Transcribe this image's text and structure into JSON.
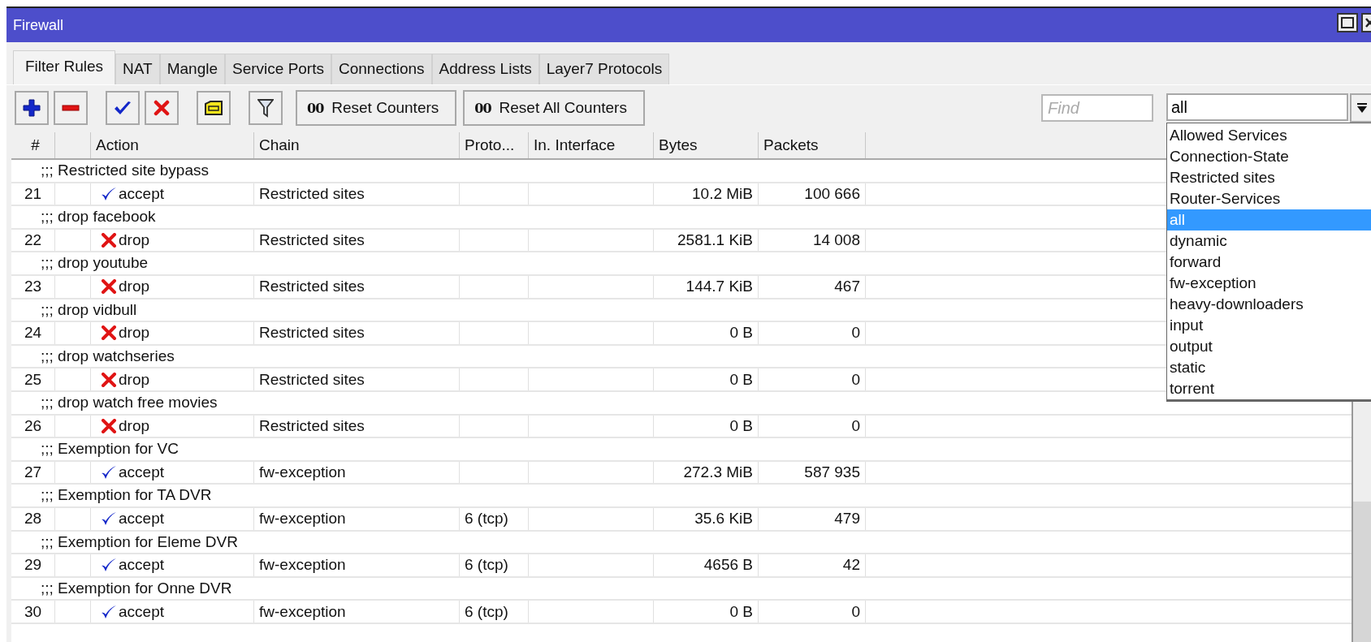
{
  "window": {
    "title": "Firewall"
  },
  "tabs": [
    {
      "label": "Filter Rules",
      "selected": true
    },
    {
      "label": "NAT",
      "selected": false
    },
    {
      "label": "Mangle",
      "selected": false
    },
    {
      "label": "Service Ports",
      "selected": false
    },
    {
      "label": "Connections",
      "selected": false
    },
    {
      "label": "Address Lists",
      "selected": false
    },
    {
      "label": "Layer7 Protocols",
      "selected": false
    }
  ],
  "toolbar": {
    "icon_buttons": [
      {
        "kind": "add"
      },
      {
        "kind": "remove"
      },
      {
        "kind": "enable"
      },
      {
        "kind": "disable"
      },
      {
        "kind": "comment"
      },
      {
        "kind": "filter"
      }
    ],
    "text_buttons": [
      {
        "glyph": "00",
        "label": "Reset Counters"
      },
      {
        "glyph": "00",
        "label": "Reset All Counters"
      }
    ],
    "find": {
      "placeholder": "Find"
    },
    "chain_filter": {
      "value": "all",
      "options": [
        {
          "label": "Allowed Services",
          "selected": false
        },
        {
          "label": "Connection-State",
          "selected": false
        },
        {
          "label": "Restricted sites",
          "selected": false
        },
        {
          "label": "Router-Services",
          "selected": false
        },
        {
          "label": "all",
          "selected": true
        },
        {
          "label": "dynamic",
          "selected": false
        },
        {
          "label": "forward",
          "selected": false
        },
        {
          "label": "fw-exception",
          "selected": false
        },
        {
          "label": "heavy-downloaders",
          "selected": false
        },
        {
          "label": "input",
          "selected": false
        },
        {
          "label": "output",
          "selected": false
        },
        {
          "label": "static",
          "selected": false
        },
        {
          "label": "torrent",
          "selected": false
        }
      ]
    }
  },
  "table": {
    "columns": [
      "#",
      "Action",
      "Chain",
      "Proto...",
      "In. Interface",
      "Bytes",
      "Packets"
    ],
    "rows": [
      {
        "kind": "comment",
        "text": ";;; Restricted site bypass"
      },
      {
        "kind": "rule",
        "number": "21",
        "action": "accept",
        "chain": "Restricted sites",
        "protocol": "",
        "bytes": "10.2 MiB",
        "packets": "100 666"
      },
      {
        "kind": "comment",
        "text": ";;; drop facebook"
      },
      {
        "kind": "rule",
        "number": "22",
        "action": "drop",
        "chain": "Restricted sites",
        "protocol": "",
        "bytes": "2581.1 KiB",
        "packets": "14 008"
      },
      {
        "kind": "comment",
        "text": ";;; drop youtube"
      },
      {
        "kind": "rule",
        "number": "23",
        "action": "drop",
        "chain": "Restricted sites",
        "protocol": "",
        "bytes": "144.7 KiB",
        "packets": "467"
      },
      {
        "kind": "comment",
        "text": ";;; drop vidbull"
      },
      {
        "kind": "rule",
        "number": "24",
        "action": "drop",
        "chain": "Restricted sites",
        "protocol": "",
        "bytes": "0 B",
        "packets": "0"
      },
      {
        "kind": "comment",
        "text": ";;; drop watchseries"
      },
      {
        "kind": "rule",
        "number": "25",
        "action": "drop",
        "chain": "Restricted sites",
        "protocol": "",
        "bytes": "0 B",
        "packets": "0"
      },
      {
        "kind": "comment",
        "text": ";;; drop watch free movies"
      },
      {
        "kind": "rule",
        "number": "26",
        "action": "drop",
        "chain": "Restricted sites",
        "protocol": "",
        "bytes": "0 B",
        "packets": "0"
      },
      {
        "kind": "comment",
        "text": ";;; Exemption for VC"
      },
      {
        "kind": "rule",
        "number": "27",
        "action": "accept",
        "chain": "fw-exception",
        "protocol": "",
        "bytes": "272.3 MiB",
        "packets": "587 935"
      },
      {
        "kind": "comment",
        "text": ";;; Exemption for TA DVR"
      },
      {
        "kind": "rule",
        "number": "28",
        "action": "accept",
        "chain": "fw-exception",
        "protocol": "6 (tcp)",
        "bytes": "35.6 KiB",
        "packets": "479"
      },
      {
        "kind": "comment",
        "text": ";;; Exemption for Eleme DVR"
      },
      {
        "kind": "rule",
        "number": "29",
        "action": "accept",
        "chain": "fw-exception",
        "protocol": "6 (tcp)",
        "bytes": "4656 B",
        "packets": "42"
      },
      {
        "kind": "comment",
        "text": ";;; Exemption for Onne DVR"
      },
      {
        "kind": "rule",
        "number": "30",
        "action": "accept",
        "chain": "fw-exception",
        "protocol": "6 (tcp)",
        "bytes": "0 B",
        "packets": "0"
      }
    ]
  }
}
